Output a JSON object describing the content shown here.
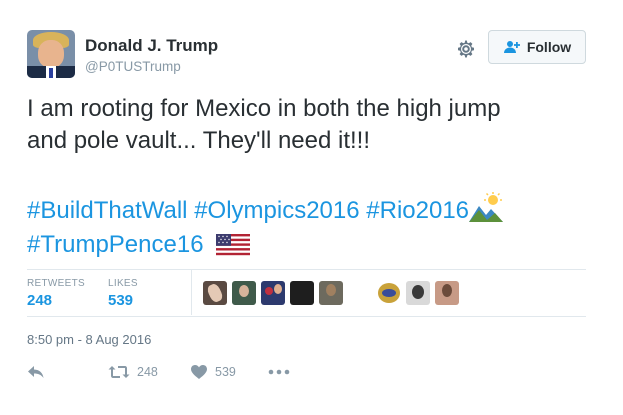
{
  "user": {
    "display_name": "Donald J. Trump",
    "handle": "@P0TUSTrump",
    "avatar_icon": "profile-photo"
  },
  "header": {
    "settings_icon": "gear-icon",
    "follow_label": "Follow",
    "follow_icon": "add-user-icon"
  },
  "tweet": {
    "text_line1": "I am rooting for Mexico in both the high jump",
    "text_line2": "and pole vault... They'll need it!!!",
    "hashtags": [
      "#BuildThatWall",
      "#Olympics2016",
      "#Rio2016",
      "#TrumpPence16"
    ],
    "emojis": [
      "sunrise-over-mountains-emoji",
      "us-flag-emoji"
    ]
  },
  "stats": {
    "retweets_label": "RETWEETS",
    "retweets_value": "248",
    "likes_label": "LIKES",
    "likes_value": "539"
  },
  "likers": [
    {
      "name": "liker-avatar-1",
      "color": "#5a4a42"
    },
    {
      "name": "liker-avatar-2",
      "color": "#3f5a4a"
    },
    {
      "name": "liker-avatar-3",
      "color": "#2d3a6e"
    },
    {
      "name": "liker-avatar-4",
      "color": "#1e1e1e"
    },
    {
      "name": "liker-avatar-5",
      "color": "#6d6a5e"
    },
    {
      "name": "liker-avatar-6",
      "color": "#c9a23a"
    },
    {
      "name": "liker-avatar-7",
      "color": "#3a3a3a"
    },
    {
      "name": "liker-avatar-8",
      "color": "#c79a86"
    }
  ],
  "timestamp": "8:50 pm - 8 Aug 2016",
  "actions": {
    "reply_icon": "reply-icon",
    "retweet_icon": "retweet-icon",
    "retweet_count": "248",
    "like_icon": "heart-icon",
    "like_count": "539",
    "more_icon": "more-dots-icon"
  },
  "colors": {
    "link": "#1b95e0",
    "text": "#292f33",
    "muted": "#8899a6",
    "divider": "#e1e8ed"
  }
}
